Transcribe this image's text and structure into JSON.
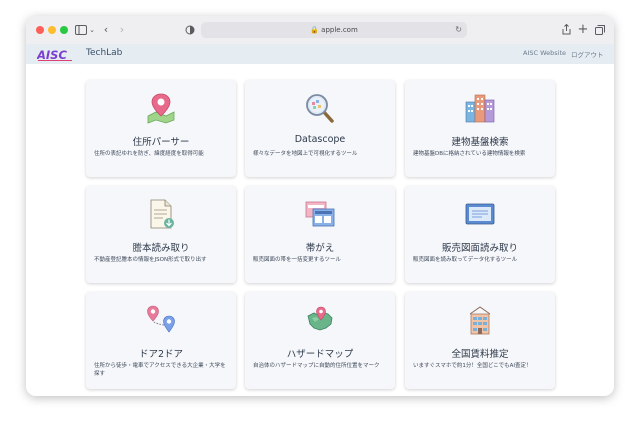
{
  "browser": {
    "url": "apple.com"
  },
  "app": {
    "logo_text": "AISC",
    "brand": "TechLab",
    "nav": {
      "website": "AISC Website",
      "logout": "ログアウト"
    }
  },
  "cards": [
    {
      "title": "住所パーサー",
      "desc": "住所の表記ゆれを防ぎ、緯度経度を取得可能",
      "icon": "map-pin-icon"
    },
    {
      "title": "Datascope",
      "desc": "様々なデータを地図上で可視化するツール",
      "icon": "magnifier-icon"
    },
    {
      "title": "建物基盤検索",
      "desc": "建物基盤DBに格納されている建物情報を検索",
      "icon": "buildings-icon"
    },
    {
      "title": "謄本読み取り",
      "desc": "不動産登記謄本の情報をJSON形式で取り出す",
      "icon": "document-icon"
    },
    {
      "title": "帯がえ",
      "desc": "販売図面の帯を一括変更するツール",
      "icon": "flyer-icon"
    },
    {
      "title": "販売図面読み取り",
      "desc": "販売図面を読み取ってデータ化するツール",
      "icon": "monitor-icon"
    },
    {
      "title": "ドア2ドア",
      "desc": "住所から徒歩・電車でアクセスできる大企業・大学を探す",
      "icon": "route-icon"
    },
    {
      "title": "ハザードマップ",
      "desc": "自治体のハザードマップに自動的住所位置をマーク",
      "icon": "hazard-map-icon"
    },
    {
      "title": "全国賃料推定",
      "desc": "いますぐスマホで約1分！全国どこでもAI査定！",
      "icon": "apartment-icon"
    }
  ]
}
